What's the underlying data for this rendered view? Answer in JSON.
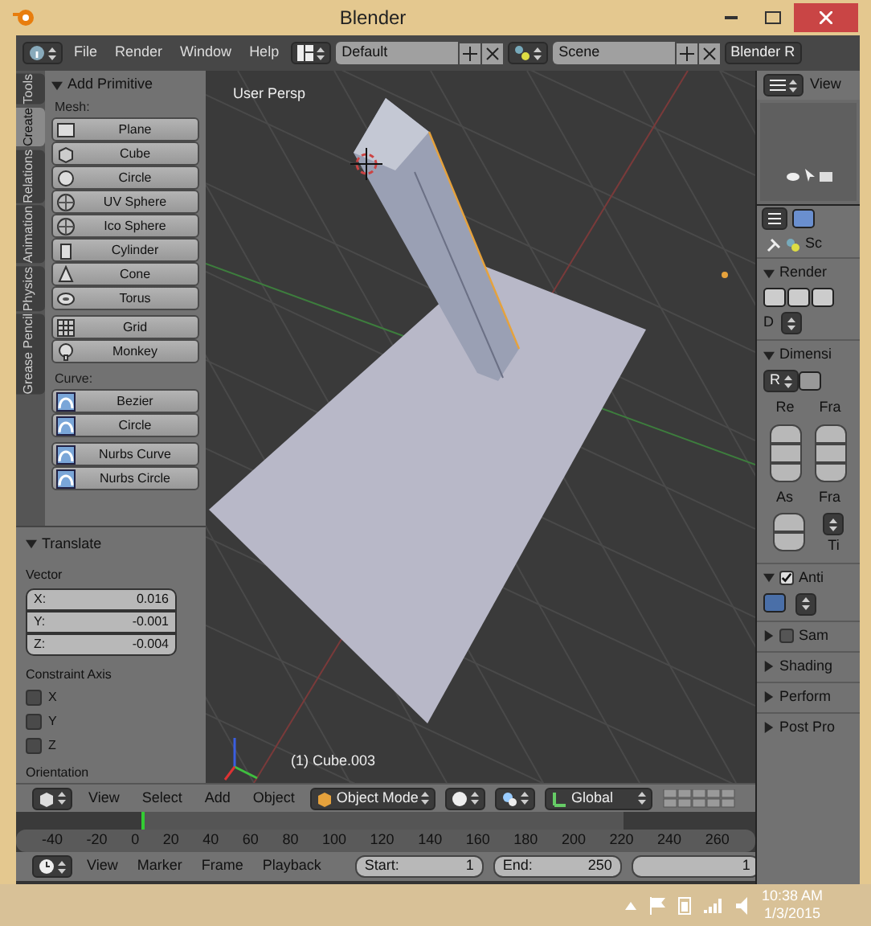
{
  "window": {
    "title": "Blender"
  },
  "menu_bar": {
    "menus": [
      "File",
      "Render",
      "Window",
      "Help"
    ],
    "layout": "Default",
    "scene": "Scene",
    "engine": "Blender R"
  },
  "tool_tabs": [
    {
      "label": "Tools",
      "selected": false
    },
    {
      "label": "Create",
      "selected": true
    },
    {
      "label": "Relations",
      "selected": false
    },
    {
      "label": "Animation",
      "selected": false
    },
    {
      "label": "Physics",
      "selected": false
    },
    {
      "label": "Grease Pencil",
      "selected": false
    }
  ],
  "add_primitive": {
    "title": "Add Primitive",
    "expanded": true,
    "sections": [
      {
        "label": "Mesh:",
        "blocks": [
          [
            {
              "label": "Plane",
              "kind": "plane"
            },
            {
              "label": "Cube",
              "kind": "cube"
            },
            {
              "label": "Circle",
              "kind": "circle"
            },
            {
              "label": "UV Sphere",
              "kind": "sphere"
            },
            {
              "label": "Ico Sphere",
              "kind": "sphere"
            },
            {
              "label": "Cylinder",
              "kind": "cylinder"
            },
            {
              "label": "Cone",
              "kind": "cone"
            },
            {
              "label": "Torus",
              "kind": "torus"
            }
          ],
          [
            {
              "label": "Grid",
              "kind": "grid"
            },
            {
              "label": "Monkey",
              "kind": "monkey"
            }
          ]
        ]
      },
      {
        "label": "Curve:",
        "blocks": [
          [
            {
              "label": "Bezier",
              "kind": "curve"
            },
            {
              "label": "Circle",
              "kind": "curve"
            }
          ],
          [
            {
              "label": "Nurbs Curve",
              "kind": "curve"
            },
            {
              "label": "Nurbs Circle",
              "kind": "curve"
            }
          ]
        ]
      }
    ]
  },
  "translate": {
    "title": "Translate",
    "expanded": true,
    "vector_label": "Vector",
    "vector": [
      {
        "axis": "X:",
        "value": "0.016"
      },
      {
        "axis": "Y:",
        "value": "-0.001"
      },
      {
        "axis": "Z:",
        "value": "-0.004"
      }
    ],
    "constraint_label": "Constraint Axis",
    "constraints": [
      {
        "label": "X",
        "checked": false
      },
      {
        "label": "Y",
        "checked": false
      },
      {
        "label": "Z",
        "checked": false
      }
    ],
    "orientation_label": "Orientation"
  },
  "viewport": {
    "view_name": "User Persp",
    "object_info": "(1) Cube.003"
  },
  "viewport_header": {
    "menus": [
      "View",
      "Select",
      "Add",
      "Object"
    ],
    "mode": "Object Mode",
    "orientation": "Global"
  },
  "timeline": {
    "ticks": [
      "-40",
      "-20",
      "0",
      "20",
      "40",
      "60",
      "80",
      "100",
      "120",
      "140",
      "160",
      "180",
      "200",
      "220",
      "240",
      "260"
    ]
  },
  "timeline_header": {
    "menus": [
      "View",
      "Marker",
      "Frame",
      "Playback"
    ],
    "fields": [
      {
        "label": "Start:",
        "value": "1"
      },
      {
        "label": "End:",
        "value": "250"
      },
      {
        "value": "1"
      }
    ]
  },
  "outliner": {
    "menu": "View"
  },
  "properties": {
    "context": "Sc",
    "sections": [
      {
        "title": "Render",
        "expanded": true,
        "kind": "render",
        "labels": [
          "D"
        ]
      },
      {
        "title": "Dimensi",
        "expanded": true,
        "kind": "dimensions",
        "labels": [
          "R",
          "Re",
          "Fra",
          "As",
          "Fra",
          "Ti"
        ]
      },
      {
        "title": "Anti",
        "expanded": true,
        "checked": true,
        "kind": "antialias"
      },
      {
        "title": "Sam",
        "expanded": false,
        "checked": false,
        "kind": "plain"
      },
      {
        "title": "Shading",
        "expanded": false,
        "kind": "plain"
      },
      {
        "title": "Perform",
        "expanded": false,
        "kind": "plain"
      },
      {
        "title": "Post Pro",
        "expanded": false,
        "kind": "plain"
      }
    ]
  },
  "taskbar": {
    "time": "10:38 AM",
    "date": "1/3/2015"
  }
}
